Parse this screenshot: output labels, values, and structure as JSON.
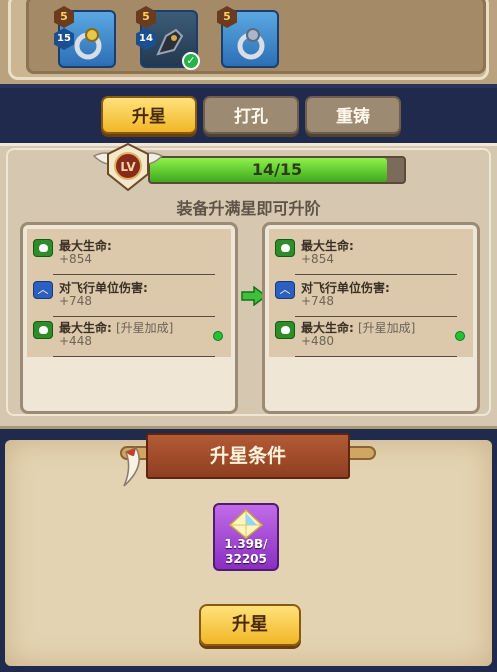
{
  "equipment_slots": [
    {
      "star": "5",
      "level": "15",
      "icon": "ring-icon",
      "equipped": false
    },
    {
      "star": "5",
      "level": "14",
      "icon": "gauntlet-icon",
      "equipped": true
    },
    {
      "star": "5",
      "level": "",
      "icon": "ring-icon",
      "equipped": false
    }
  ],
  "tabs": [
    {
      "label": "升星",
      "active": true
    },
    {
      "label": "打孔",
      "active": false
    },
    {
      "label": "重铸",
      "active": false
    }
  ],
  "progress": {
    "text": "14/15",
    "current": 14,
    "max": 15,
    "badge_label": "LV"
  },
  "upgrade_hint": "装备升满星即可升阶",
  "current_stats": [
    {
      "icon": "heart-shield-icon",
      "name": "最大生命:",
      "tag": "",
      "value": "+854"
    },
    {
      "icon": "flying-unit-icon",
      "name": "对飞行单位伤害:",
      "tag": "",
      "value": "+748"
    },
    {
      "icon": "heart-shield-icon",
      "name": "最大生命:",
      "tag": "[升星加成]",
      "value": "+448"
    }
  ],
  "next_stats": [
    {
      "icon": "heart-shield-icon",
      "name": "最大生命:",
      "tag": "",
      "value": "+854"
    },
    {
      "icon": "flying-unit-icon",
      "name": "对飞行单位伤害:",
      "tag": "",
      "value": "+748"
    },
    {
      "icon": "heart-shield-icon",
      "name": "最大生命:",
      "tag": "[升星加成]",
      "value": "+480"
    }
  ],
  "conditions": {
    "title": "升星条件",
    "material": {
      "icon": "crystal-icon",
      "owned": "1.39B/",
      "required": "32205"
    }
  },
  "action_button": "升星",
  "colors": {
    "accent_gold": "#f1b628",
    "progress_green": "#3fa81f",
    "banner_red": "#b45a36",
    "material_purple": "#8a2fc2"
  }
}
